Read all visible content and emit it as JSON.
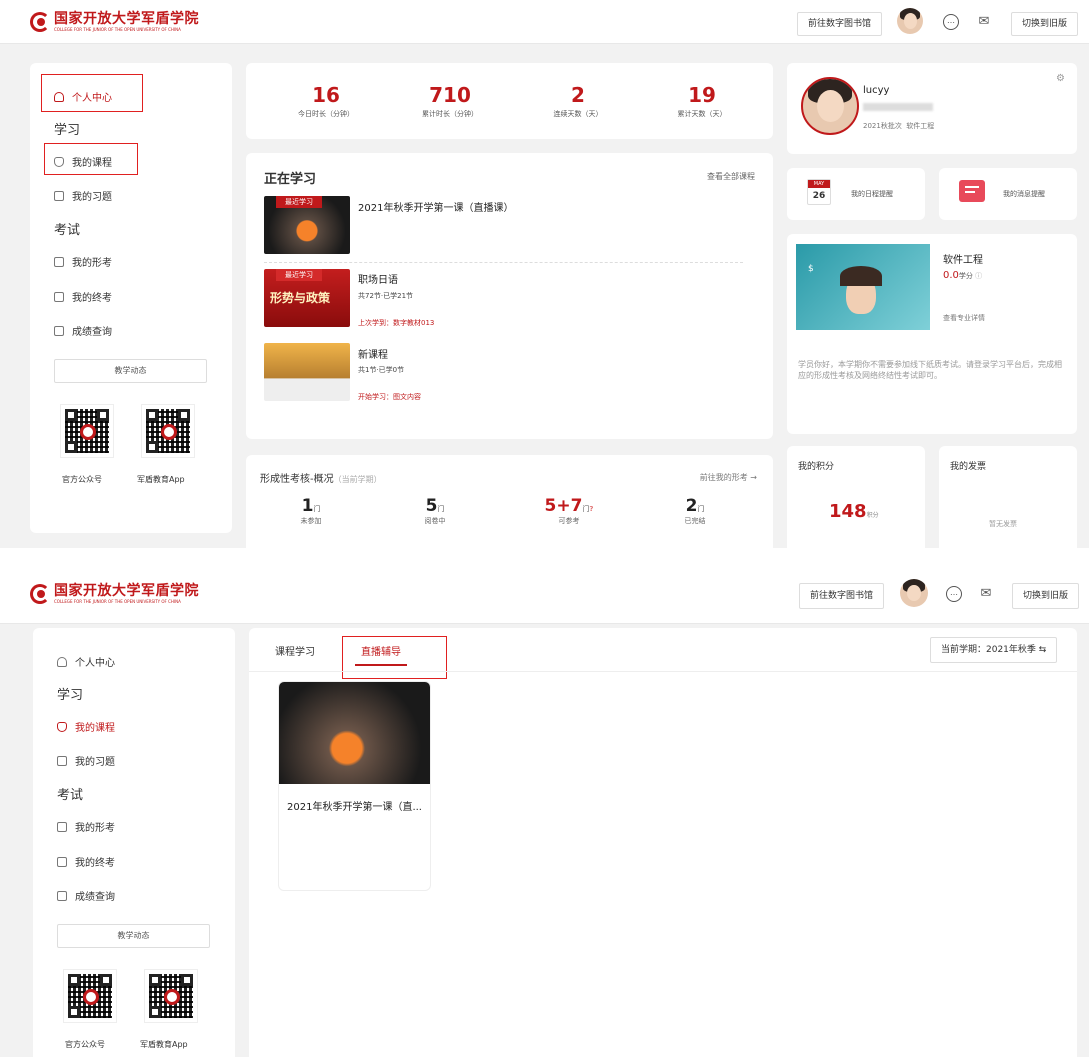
{
  "brand": {
    "name_cn": "国家开放大学军盾学院",
    "name_en": "COLLEGE FOR THE JUNIOR OF THE OPEN UNIVERSITY OF CHINA"
  },
  "header": {
    "library_btn": "前往数字图书馆",
    "switch_btn": "切换到旧版",
    "chat_icon": "chat-icon",
    "mail_icon": "mail-icon"
  },
  "sidebar": {
    "personal_center": "个人中心",
    "section_study": "学习",
    "my_courses": "我的课程",
    "my_exercises": "我的习题",
    "section_exam": "考试",
    "my_formative": "我的形考",
    "my_final": "我的终考",
    "grade_query": "成绩查询",
    "news_btn": "教学动态",
    "qr_official": "官方公众号",
    "qr_app": "军盾教育App"
  },
  "stats": [
    {
      "value": "16",
      "label": "今日时长（分钟）"
    },
    {
      "value": "710",
      "label": "累计时长（分钟）"
    },
    {
      "value": "2",
      "label": "连续天数（天）"
    },
    {
      "value": "19",
      "label": "累计天数（天）"
    }
  ],
  "learning": {
    "title": "正在学习",
    "view_all": "查看全部课程",
    "recent_tag": "最近学习",
    "courses": [
      {
        "title": "2021年秋季开学第一课（直播课）"
      },
      {
        "title": "职场日语",
        "thumb_text": "形势与政策",
        "progress": "共72节·已学21节",
        "last": "上次学到：数字教材013"
      },
      {
        "title": "新课程",
        "progress": "共1节·已学0节",
        "last": "开始学习：图文内容"
      }
    ]
  },
  "formative": {
    "title": "形成性考核-概况",
    "sub": "（当前学期）",
    "link": "前往我的形考 →",
    "unit": "门",
    "items": [
      {
        "value": "1",
        "label": "未参加"
      },
      {
        "value": "5",
        "label": "阅卷中"
      },
      {
        "value": "5+7",
        "label": "可参考"
      },
      {
        "value": "2",
        "label": "已完结"
      }
    ]
  },
  "profile": {
    "name": "lucyy",
    "meta": "2021秋批次  软件工程"
  },
  "reminders": {
    "calendar_month": "MAY",
    "calendar_day": "26",
    "schedule": "我的日程提醒",
    "message": "我的消息提醒"
  },
  "major": {
    "name": "软件工程",
    "credits": "0.0",
    "credits_unit": "学分",
    "details_link": "查看专业详情",
    "notice": "学员你好，本学期你不需要参加线下纸质考试。请登录学习平台后，完成相应的形成性考核及网络终结性考试即可。"
  },
  "points": {
    "title": "我的积分",
    "value": "148",
    "unit": "积分"
  },
  "invoice": {
    "title": "我的发票",
    "empty": "暂无发票"
  },
  "courses_page": {
    "tab1": "课程学习",
    "tab2": "直播辅导",
    "term": "当前学期：2021年秋季",
    "card_title": "2021年秋季开学第一课（直..."
  }
}
